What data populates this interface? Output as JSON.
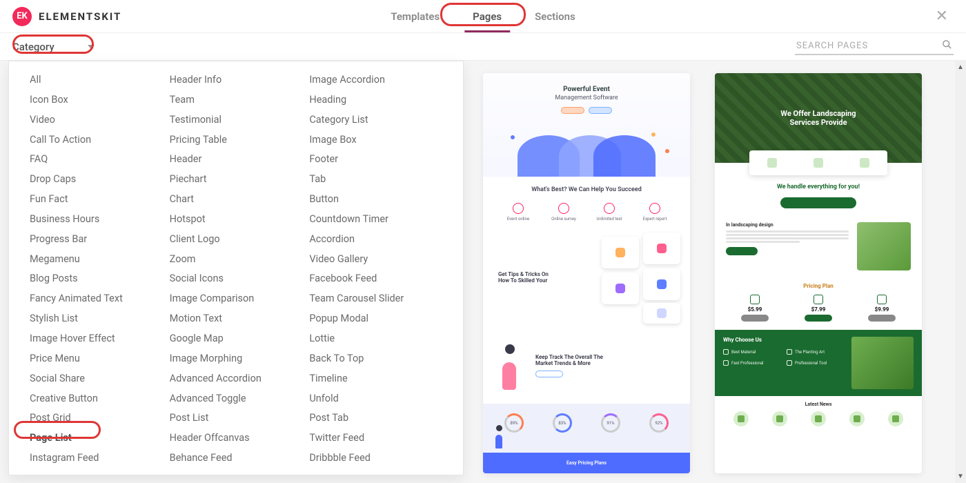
{
  "brand": {
    "badge": "EK",
    "name": "ELEMENTSKIT"
  },
  "nav": {
    "templates": "Templates",
    "pages": "Pages",
    "sections": "Sections"
  },
  "toolbar": {
    "category_label": "Category",
    "search_placeholder": "SEARCH PAGES"
  },
  "dropdown": {
    "col1": [
      "All",
      "Icon Box",
      "Video",
      "Call To Action",
      "FAQ",
      "Drop Caps",
      "Fun Fact",
      "Business Hours",
      "Progress Bar",
      "Megamenu",
      "Blog Posts",
      "Fancy Animated Text",
      "Stylish List",
      "Image Hover Effect",
      "Price Menu",
      "Social Share",
      "Creative Button",
      "Post Grid",
      "Page List",
      "Instagram Feed"
    ],
    "col2": [
      "Header Info",
      "Team",
      "Testimonial",
      "Pricing Table",
      "Header",
      "Piechart",
      "Chart",
      "Hotspot",
      "Client Logo",
      "Zoom",
      "Social Icons",
      "Image Comparison",
      "Motion Text",
      "Google Map",
      "Image Morphing",
      "Advanced Accordion",
      "Advanced Toggle",
      "Post List",
      "Header Offcanvas",
      "Behance Feed"
    ],
    "col3": [
      "Image Accordion",
      "Heading",
      "Category List",
      "Image Box",
      "Footer",
      "Tab",
      "Button",
      "Countdown Timer",
      "Accordion",
      "Video Gallery",
      "Facebook Feed",
      "Team Carousel Slider",
      "Popup Modal",
      "Lottie",
      "Back To Top",
      "Timeline",
      "Unfold",
      "Post Tab",
      "Twitter Feed",
      "Dribbble Feed"
    ]
  },
  "cardA": {
    "hero_title": "Powerful Event",
    "hero_sub": "Management Software",
    "sec2_title": "What's Best? We Can Help You Succeed",
    "features": [
      "Event online",
      "Online survey",
      "Unlimited test",
      "Expert report"
    ],
    "tip": "Get Tips & Tricks On How To Skilled Your",
    "track": "Keep Track The Overall The Market Trends & More",
    "dials": [
      "89%",
      "83%",
      "91%",
      "92%"
    ],
    "footer": "Easy Pricing Plans"
  },
  "cardB": {
    "hero": "We Offer Landscaping Services Provide",
    "handle": "We handle everything for you!",
    "pill": "",
    "design_title": "In landscaping design",
    "pricing_title": "Pricing Plan",
    "prices": [
      "$5.99",
      "$7.99",
      "$9.99"
    ],
    "why_title": "Why Choose Us",
    "why_items": [
      "Best Material",
      "The Planting Art",
      "Fast Professional",
      "Professional Tool"
    ],
    "news_title": "Latest News"
  }
}
